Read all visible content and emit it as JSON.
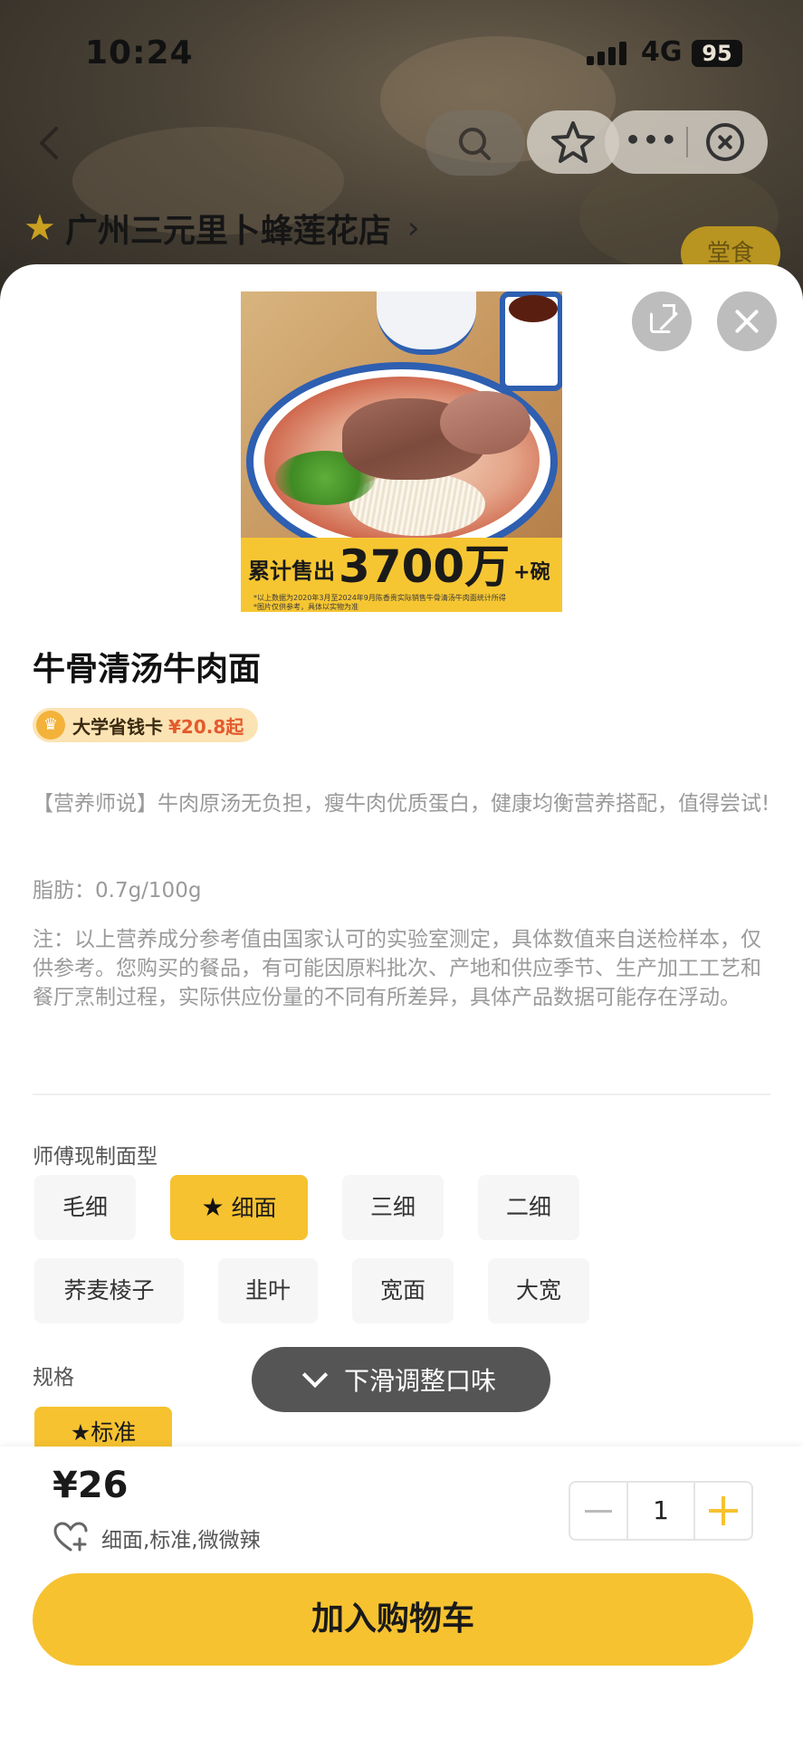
{
  "status_bar": {
    "time": "10:24",
    "network": "4G",
    "battery": "95"
  },
  "background_page": {
    "store_name": "广州三元里卜蜂莲花店",
    "dine_badge": "堂食"
  },
  "hero": {
    "promo_prefix": "累计售出",
    "promo_big": "3700万",
    "promo_suffix": "+碗",
    "promo_fine_1": "*以上数据为2020年3月至2024年9月陈香贵实际销售牛骨清汤牛肉面统计所得",
    "promo_fine_2": "*图片仅供参考，具体以实物为准"
  },
  "product": {
    "title": "牛骨清汤牛肉面",
    "card_label": "大学省钱卡",
    "card_price": "¥20.8起",
    "description": "【营养师说】牛肉原汤无负担，瘦牛肉优质蛋白，健康均衡营养搭配，值得尝试!",
    "fat": "脂肪：0.7g/100g",
    "note": "注：以上营养成分参考值由国家认可的实验室测定，具体数值来自送检样本，仅供参考。您购买的餐品，有可能因原料批次、产地和供应季节、生产加工工艺和餐厅烹制过程，实际供应份量的不同有所差异，具体产品数据可能存在浮动。"
  },
  "noodle_section": {
    "label": "师傅现制面型",
    "options": [
      "毛细",
      "细面",
      "三细",
      "二细",
      "荞麦棱子",
      "韭叶",
      "宽面",
      "大宽"
    ],
    "selected": "细面"
  },
  "spec_section": {
    "label": "规格",
    "selected": "标准"
  },
  "toast": {
    "text": "下滑调整口味"
  },
  "bottom_bar": {
    "price": "¥26",
    "summary": "细面,标准,微微辣",
    "quantity": "1",
    "add_to_cart": "加入购物车"
  },
  "colors": {
    "accent": "#f6c230",
    "promo_price": "#e55a2c",
    "muted_text": "#9a9a9a"
  },
  "icons": [
    "back-icon",
    "search-icon",
    "star-icon",
    "more-icon",
    "close-circle-icon",
    "share-icon",
    "close-icon",
    "crown-icon",
    "chevron-down-icon",
    "heart-plus-icon",
    "minus-icon",
    "plus-icon"
  ]
}
